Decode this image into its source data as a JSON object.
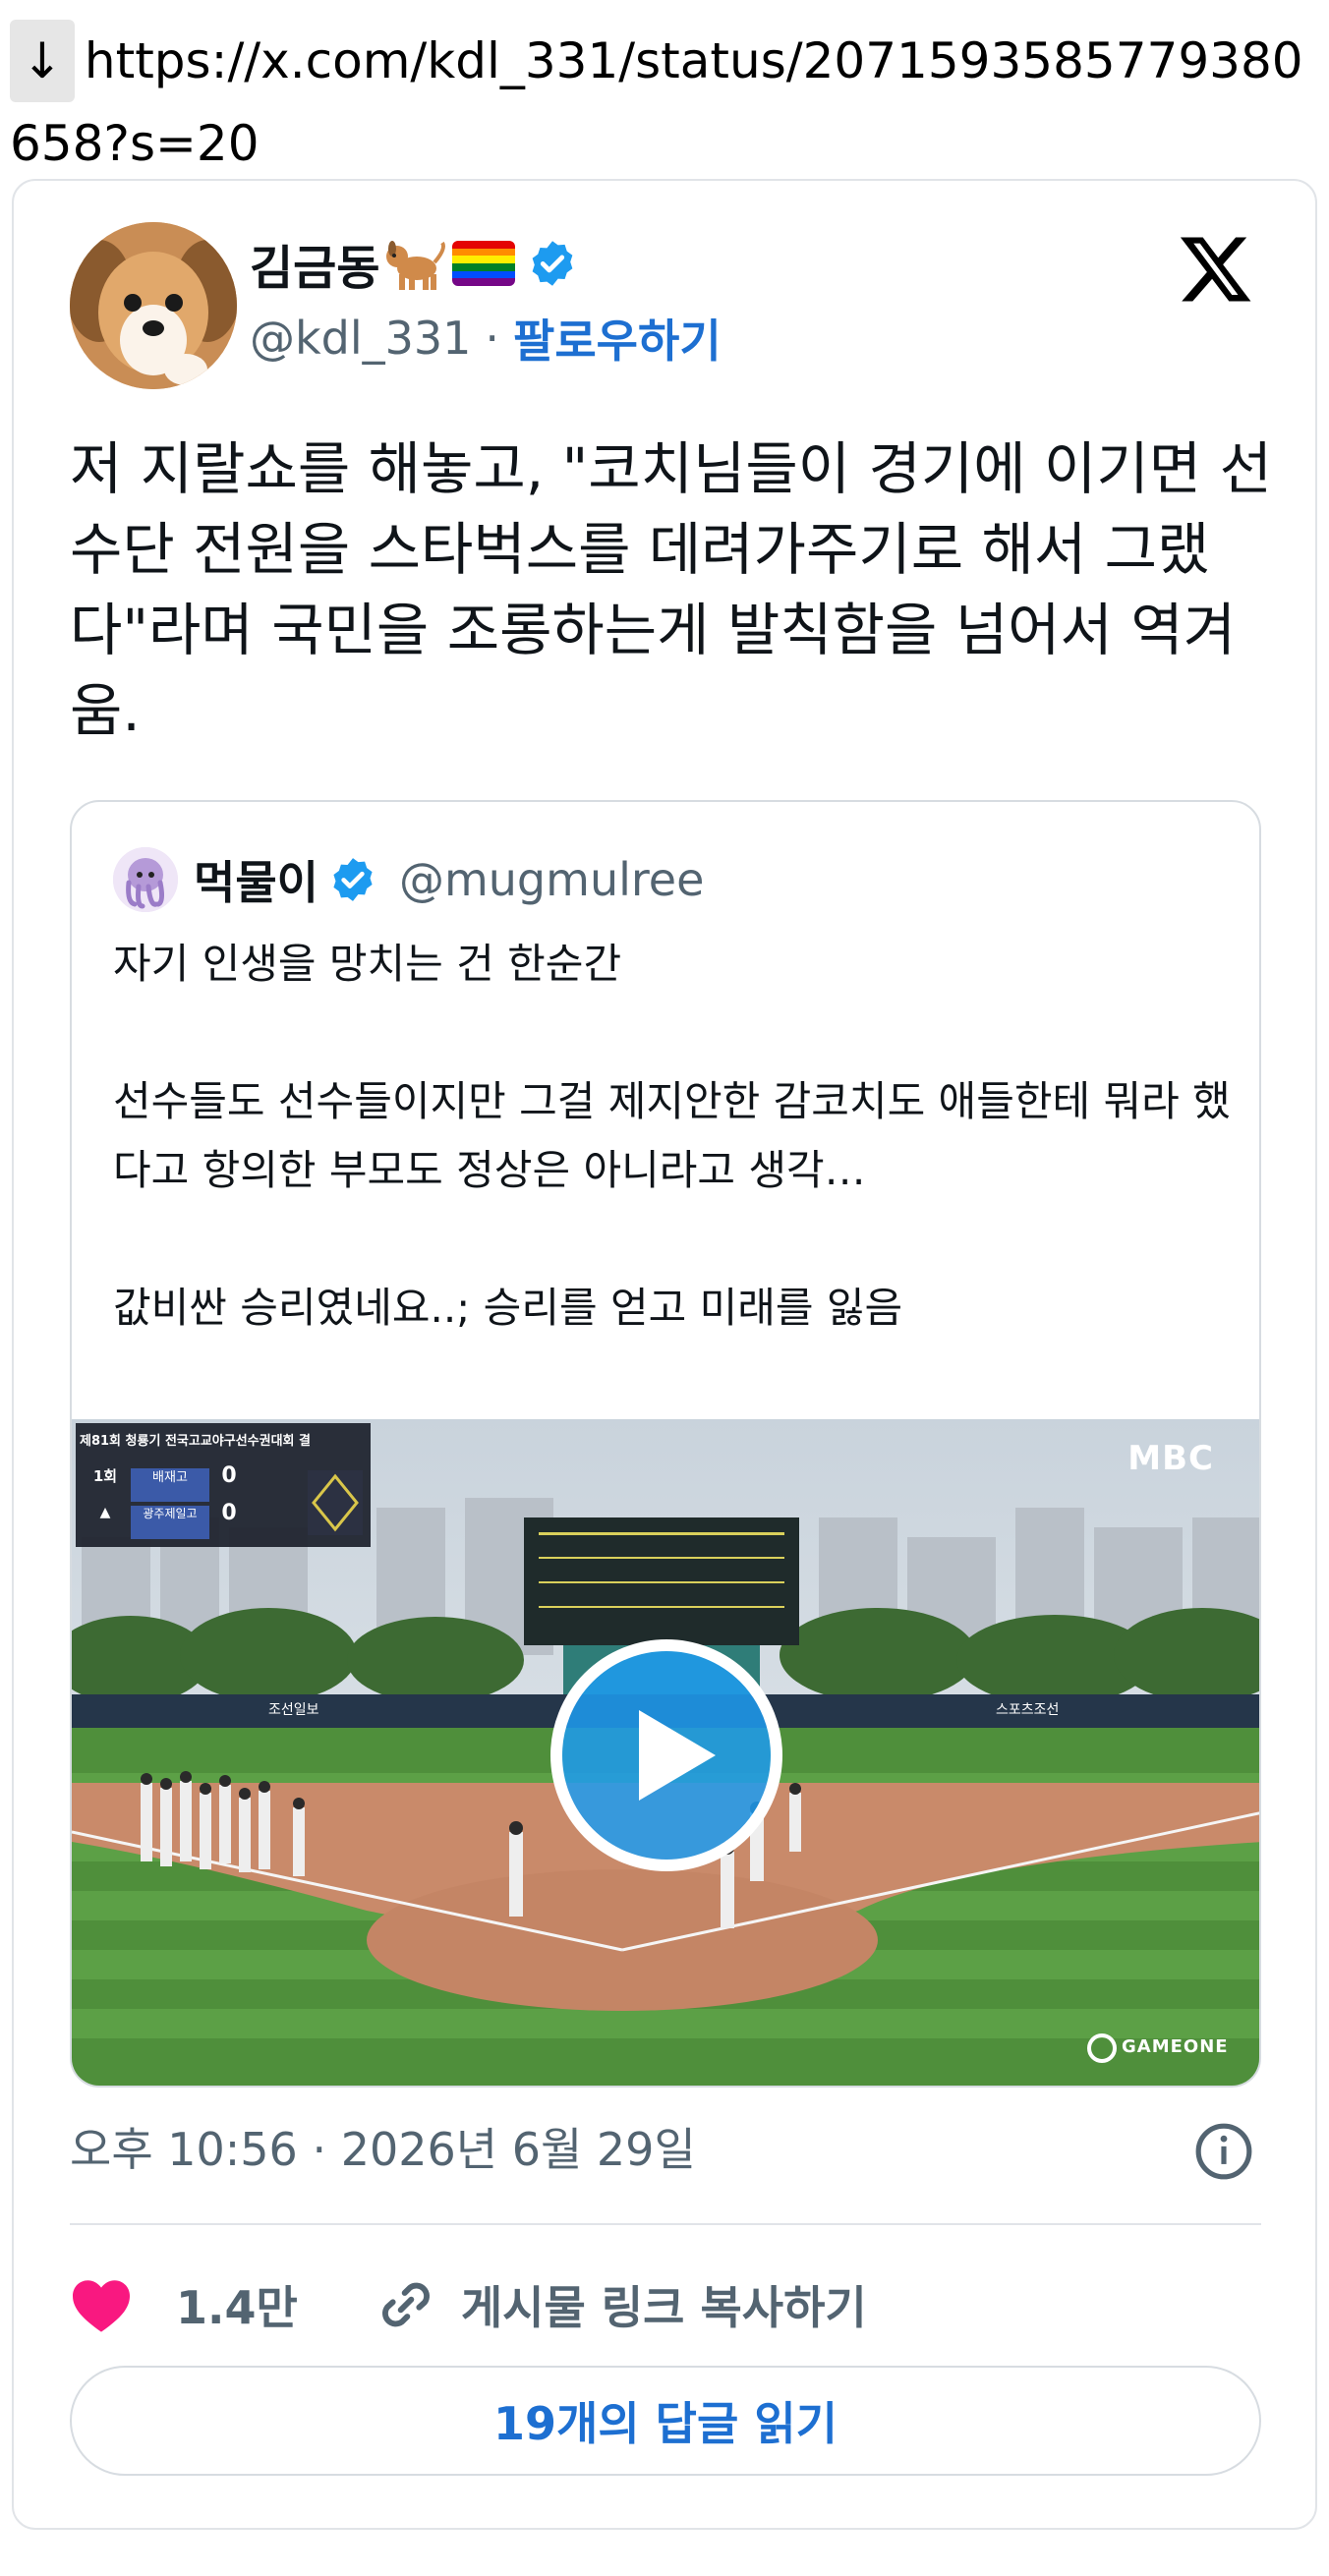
{
  "url_bar": {
    "arrow": "↓",
    "url": "https://x.com/kdl_331/status/2071593585779380658?s=20"
  },
  "tweet": {
    "author_name": "김금동",
    "author_emoji": "🐕🏳️‍🌈",
    "handle": "@kdl_331",
    "separator": "·",
    "follow_label": "팔로우하기",
    "text": "저 지랄쇼를 해놓고, \"코치님들이 경기에 이기면 선수단 전원을 스타벅스를 데려가주기로 해서 그랬다\"라며 국민을 조롱하는게 발칙함을 넘어서 역겨움.",
    "timestamp": "오후 10:56 · 2026년 6월 29일",
    "like_count": "1.4만",
    "copy_link_label": "게시물 링크 복사하기",
    "replies_label": "19개의 답글 읽기"
  },
  "quoted_tweet": {
    "author_name": "먹물이",
    "handle": "@mugmulree",
    "lines": [
      "자기 인생을 망치는 건 한순간",
      "",
      "선수들도 선수들이지만 그걸 제지안한 감코치도 애들한테 뭐라 했다고 항의한 부모도 정상은 아니라고 생각…",
      "",
      "값비싼 승리였네요..; 승리를 얻고 미래를 잃음"
    ]
  },
  "video": {
    "scoreboard_title": "제81회 청룡기 전국고교야구선수권대회 결",
    "inning": "1회",
    "team_away": "배재고",
    "score_away": "0",
    "team_home": "광주제일고",
    "score_home": "0",
    "channel_logo": "MBC",
    "banner_left": "조선일보",
    "banner_right": "스포츠조선",
    "watermark": "GAMEONE"
  },
  "colors": {
    "accent_blue": "#1d6fd1",
    "verified_blue": "#1d9bf0",
    "heart_pink": "#f91880",
    "muted_text": "#536471"
  }
}
